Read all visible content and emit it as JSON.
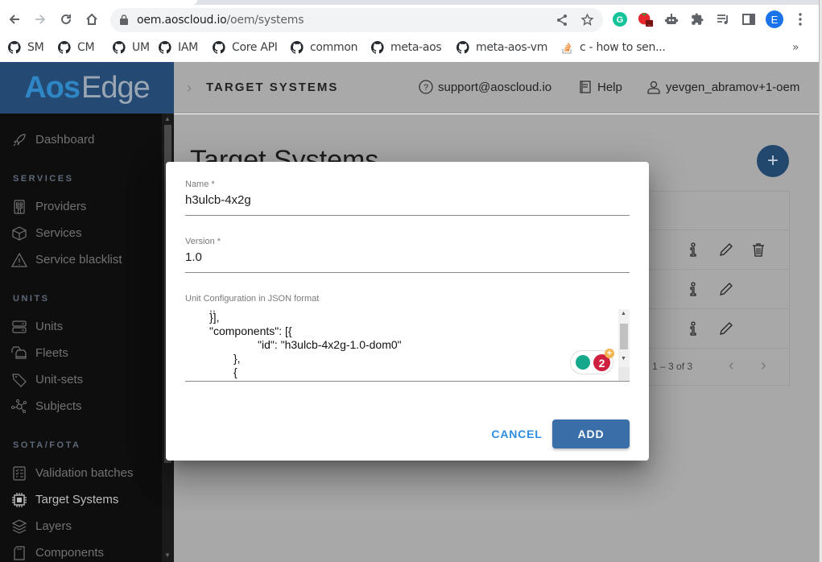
{
  "browser": {
    "url_host": "oem.aoscloud.io",
    "url_path": "/oem/systems",
    "profile_initial": "E",
    "bookmarks": [
      {
        "label": "SM",
        "icon": "github-icon"
      },
      {
        "label": "CM",
        "icon": "github-icon"
      },
      {
        "label": "UM",
        "icon": "github-icon"
      },
      {
        "label": "IAM",
        "icon": "github-icon"
      },
      {
        "label": "Core API",
        "icon": "github-icon"
      },
      {
        "label": "common",
        "icon": "github-icon"
      },
      {
        "label": "meta-aos",
        "icon": "github-icon"
      },
      {
        "label": "meta-aos-vm",
        "icon": "github-icon"
      },
      {
        "label": "c - how to sen...",
        "icon": "stackoverflow-icon"
      }
    ],
    "bookmarks_overflow": "»"
  },
  "app": {
    "logo_part1": "Aos",
    "logo_part2": "Edge",
    "breadcrumb": "TARGET SYSTEMS",
    "support_email": "support@aoscloud.io",
    "help_label": "Help",
    "user_name": "yevgen_abramov+1-oem"
  },
  "sidebar": {
    "dashboard": "Dashboard",
    "sections": [
      {
        "title": "SERVICES",
        "items": [
          "Providers",
          "Services",
          "Service blacklist"
        ]
      },
      {
        "title": "UNITS",
        "items": [
          "Units",
          "Fleets",
          "Unit-sets",
          "Subjects"
        ]
      },
      {
        "title": "SOTA/FOTA",
        "items": [
          "Validation batches",
          "Target Systems",
          "Layers",
          "Components"
        ]
      }
    ],
    "active": "Target Systems"
  },
  "main": {
    "page_title": "Target Systems",
    "pagination": "1 – 3 of 3",
    "rows": 3
  },
  "dialog": {
    "name_label": "Name *",
    "name_value": "h3ulcb-4x2g",
    "version_label": "Version *",
    "version_value": "1.0",
    "config_label": "Unit Configuration in JSON format",
    "config_lines": [
      "}],",
      "\"components\": [{",
      "\"id\": \"h3ulcb-4x2g-1.0-dom0\"",
      "},",
      "{"
    ],
    "grammarly_count": "2",
    "cancel_label": "CANCEL",
    "add_label": "ADD"
  }
}
